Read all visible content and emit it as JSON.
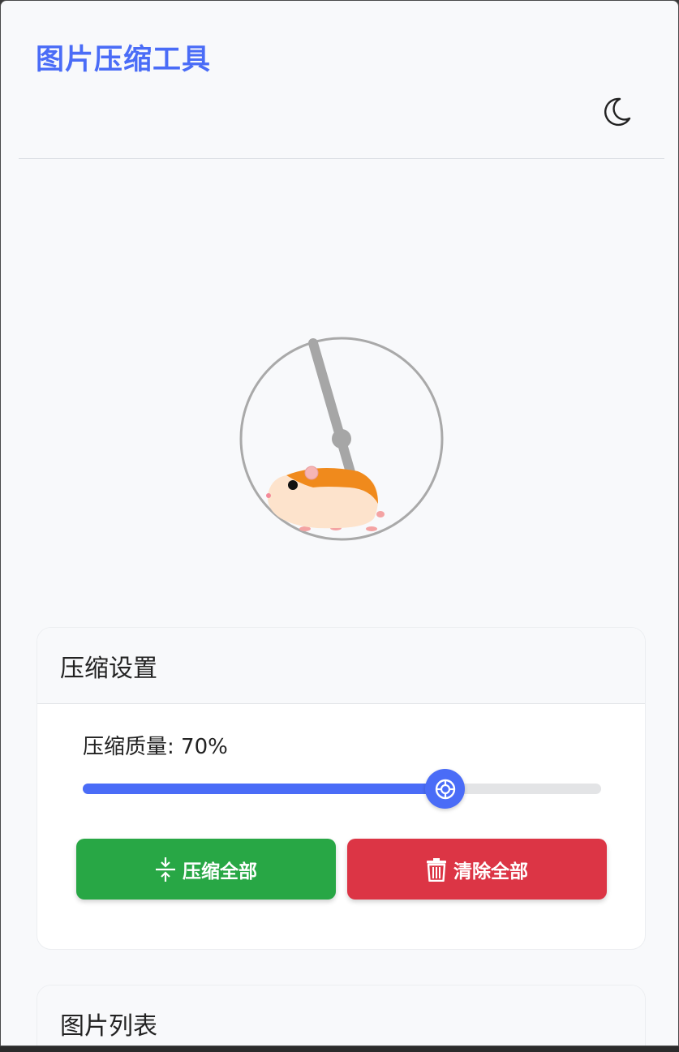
{
  "app": {
    "title": "图片压缩工具"
  },
  "settings": {
    "header": "压缩设置",
    "quality_label": "压缩质量",
    "quality_value": "70%",
    "quality": 70,
    "compress_all_label": "压缩全部",
    "clear_all_label": "清除全部"
  },
  "image_list": {
    "header": "图片列表"
  },
  "icons": {
    "theme_toggle": "moon-icon",
    "compress": "compress-arrows-icon",
    "clear": "trash-icon",
    "slider_thumb": "wheel-icon",
    "loader": "hamster-wheel-icon"
  },
  "colors": {
    "accent": "#4a6cf7",
    "success": "#28a745",
    "danger": "#dc3545",
    "background": "#f8f9fb"
  }
}
